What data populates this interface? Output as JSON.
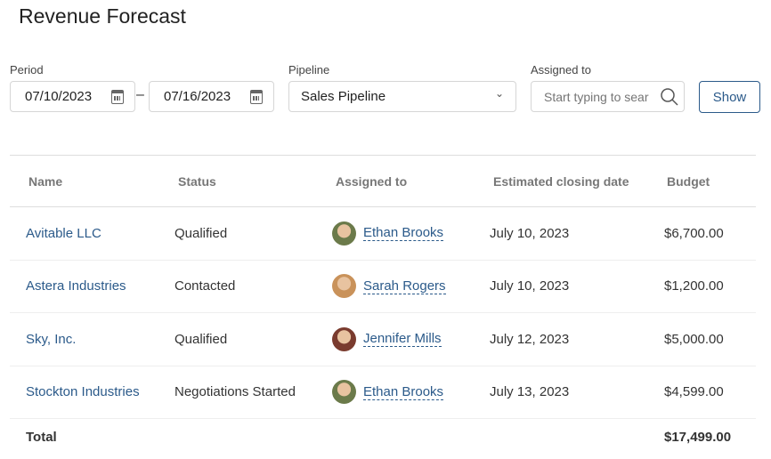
{
  "title": "Revenue Forecast",
  "filters": {
    "period_label": "Period",
    "date_from": "07/10/2023",
    "date_to": "07/16/2023",
    "separator": "–",
    "pipeline_label": "Pipeline",
    "pipeline_value": "Sales Pipeline",
    "assigned_label": "Assigned to",
    "assigned_placeholder": "Start typing to sear",
    "show_label": "Show"
  },
  "table": {
    "headers": [
      "Name",
      "Status",
      "Assigned to",
      "Estimated closing date",
      "Budget"
    ],
    "rows": [
      {
        "name": "Avitable LLC",
        "status": "Qualified",
        "assigned": "Ethan Brooks",
        "date": "July 10, 2023",
        "budget": "$6,700.00",
        "avatar": "#6b7a4a"
      },
      {
        "name": "Astera Industries",
        "status": "Contacted",
        "assigned": "Sarah Rogers",
        "date": "July 10, 2023",
        "budget": "$1,200.00",
        "avatar": "#c9925a"
      },
      {
        "name": "Sky, Inc.",
        "status": "Qualified",
        "assigned": "Jennifer Mills",
        "date": "July 12, 2023",
        "budget": "$5,000.00",
        "avatar": "#7a3b2e"
      },
      {
        "name": "Stockton Industries",
        "status": "Negotiations Started",
        "assigned": "Ethan Brooks",
        "date": "July 13, 2023",
        "budget": "$4,599.00",
        "avatar": "#6b7a4a"
      }
    ],
    "total_label": "Total",
    "total_value": "$17,499.00"
  }
}
